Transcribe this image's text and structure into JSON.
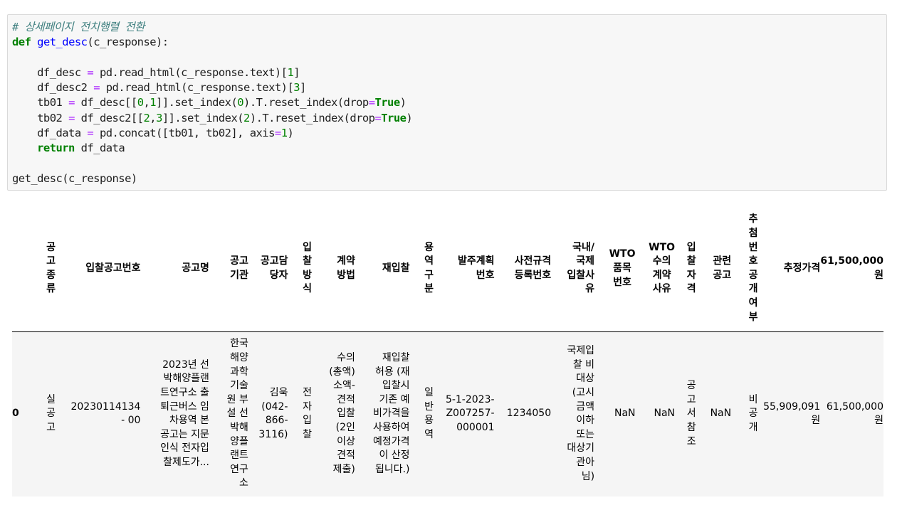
{
  "code": {
    "comment": "# 상세페이지 전치행렬 전환",
    "def_kw": "def",
    "func_name": "get_desc",
    "params": "(c_response):",
    "line_desc_a": "df_desc ",
    "line_desc_b": " pd.read_html(c_response.text)[",
    "line_desc_n": "1",
    "line_desc2_a": "df_desc2 ",
    "line_desc2_b": " pd.read_html(c_response.text)[",
    "line_desc2_n": "3",
    "tb01_a": "tb01 ",
    "tb01_b": " df_desc[[",
    "tb01_n1": "0",
    "tb01_n2": "1",
    "tb01_c": "]].set_index(",
    "tb01_d": ").T.reset_index(drop",
    "tb02_a": "tb02 ",
    "tb02_b": " df_desc2[[",
    "tb02_n1": "2",
    "tb02_n2": "3",
    "tb02_c": "]].set_index(",
    "tb02_d": ").T.reset_index(drop",
    "true_kw": "True",
    "concat_a": "df_data ",
    "concat_b": " pd.concat([tb01, tb02], axis",
    "concat_n": "1",
    "return_kw": "return",
    "return_val": " df_data",
    "call": "get_desc(c_response)",
    "eq": "=",
    "comma": ",",
    "close_br": "]",
    "close_paren": ")"
  },
  "table": {
    "columns": [
      "",
      "공\n고\n종\n류",
      "입찰공고번호",
      "공고명",
      "공고\n기관",
      "공고담\n당자",
      "입\n찰\n방\n식",
      "계약\n방법",
      "재입찰",
      "용\n역\n구\n분",
      "발주계획\n번호",
      "사전규격\n등록번호",
      "국내/\n국제\n입찰사\n유",
      "WTO\n품목\n번호",
      "WTO\n수의\n계약\n사유",
      "입\n찰\n자\n격",
      "관련\n공고",
      "추\n첨\n번\n호\n공\n개\n여\n부",
      "추정가격",
      "61,500,000\n원"
    ],
    "row": [
      "0",
      "실\n공\n고",
      "20230114134\n- 00",
      "2023년 선\n박해양플랜\n트연구소 출\n퇴근버스 임\n차용역 본\n공고는 지문\n인식 전자입\n찰제도가...",
      "한국\n해양\n과학\n기술\n원 부\n설 선\n박해\n양플\n랜트\n연구\n소",
      "김욱\n(042-\n866-\n3116)",
      "전\n자\n입\n찰",
      "수의\n(총액)\n소액-\n견적\n입찰\n(2인\n이상\n견적\n제출)",
      "재입찰\n허용 (재\n입찰시\n기존 예\n비가격을\n사용하여\n예정가격\n이 산정\n됩니다.)",
      "일\n반\n용\n역",
      "5-1-2023-\nZ007257-\n000001",
      "1234050",
      "국제입\n찰 비\n대상\n(고시\n금액\n이하\n또는\n대상기\n관아\n님)",
      "NaN",
      "NaN",
      "공\n고\n서\n참\n조",
      "NaN",
      "비\n공\n개",
      "55,909,091\n원",
      "61,500,000\n원"
    ]
  }
}
